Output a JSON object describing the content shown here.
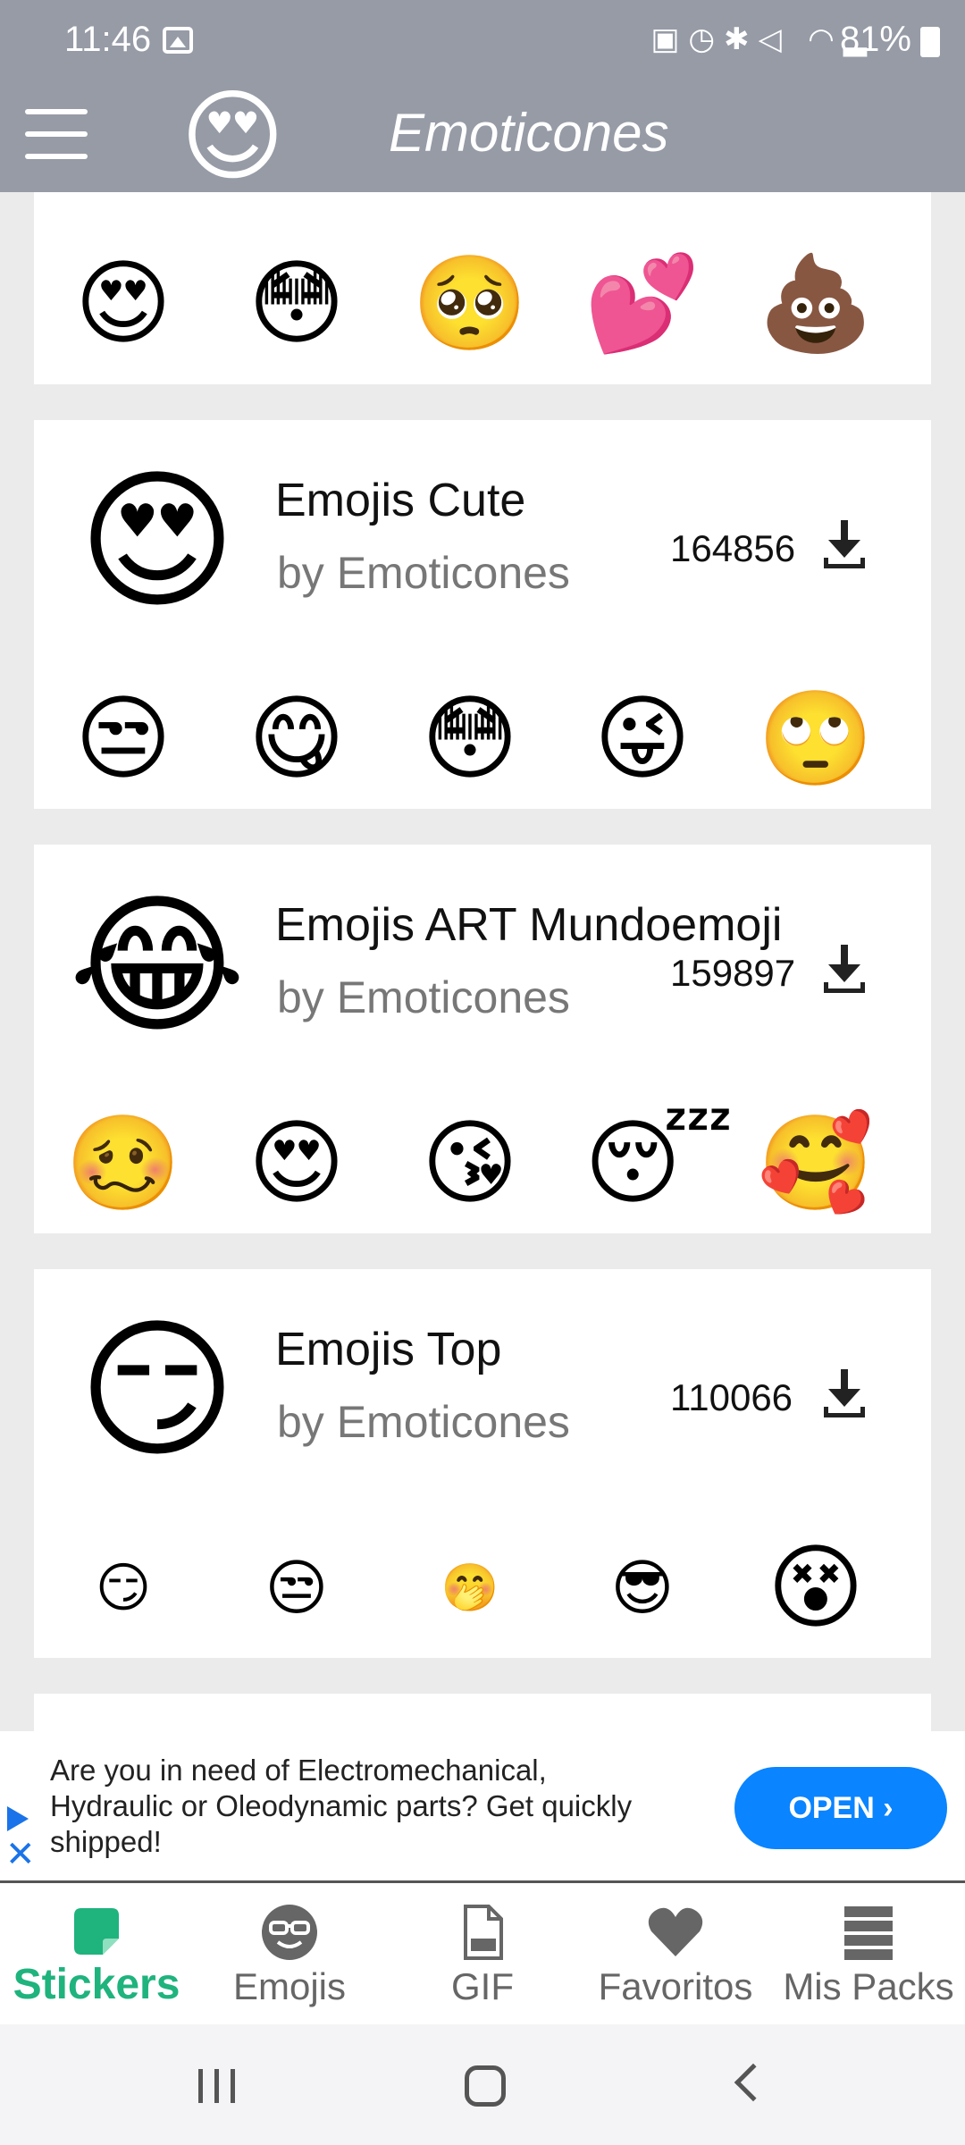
{
  "status_bar": {
    "time": "11:46",
    "battery": "81%"
  },
  "app_bar": {
    "title": "Emoticones",
    "logo": "😍"
  },
  "packs": [
    {
      "title": "",
      "author": "",
      "count": "",
      "thumbs": [
        "😍",
        "😳",
        "🥺",
        "💕",
        "💩"
      ]
    },
    {
      "title": "Emojis Cute",
      "author": "by Emoticones",
      "count": "164856",
      "cover": "😍",
      "thumbs": [
        "😒",
        "😋",
        "😳",
        "😜",
        "🙄"
      ]
    },
    {
      "title": "Emojis ART Mundoemoji",
      "author": "by Emoticones",
      "count": "159897",
      "cover": "😂",
      "thumbs": [
        "🥴",
        "😍",
        "😘",
        "😴",
        "🥰"
      ]
    },
    {
      "title": "Emojis Top",
      "author": "by Emoticones",
      "count": "110066",
      "cover": "😏",
      "thumbs": [
        "😏",
        "😒",
        "🤭",
        "😎",
        "😵"
      ]
    }
  ],
  "ad": {
    "text": "Are you in need of Electromechanical, Hydraulic or Oleodynamic parts? Get quickly shipped!",
    "button": "OPEN ›"
  },
  "bottom_nav": [
    {
      "label": "Stickers",
      "icon": "sticker-icon",
      "active": true
    },
    {
      "label": "Emojis",
      "icon": "emoji-face-icon",
      "active": false
    },
    {
      "label": "GIF",
      "icon": "gif-file-icon",
      "active": false
    },
    {
      "label": "Favoritos",
      "icon": "heart-icon",
      "active": false
    },
    {
      "label": "Mis Packs",
      "icon": "stack-icon",
      "active": false
    }
  ]
}
